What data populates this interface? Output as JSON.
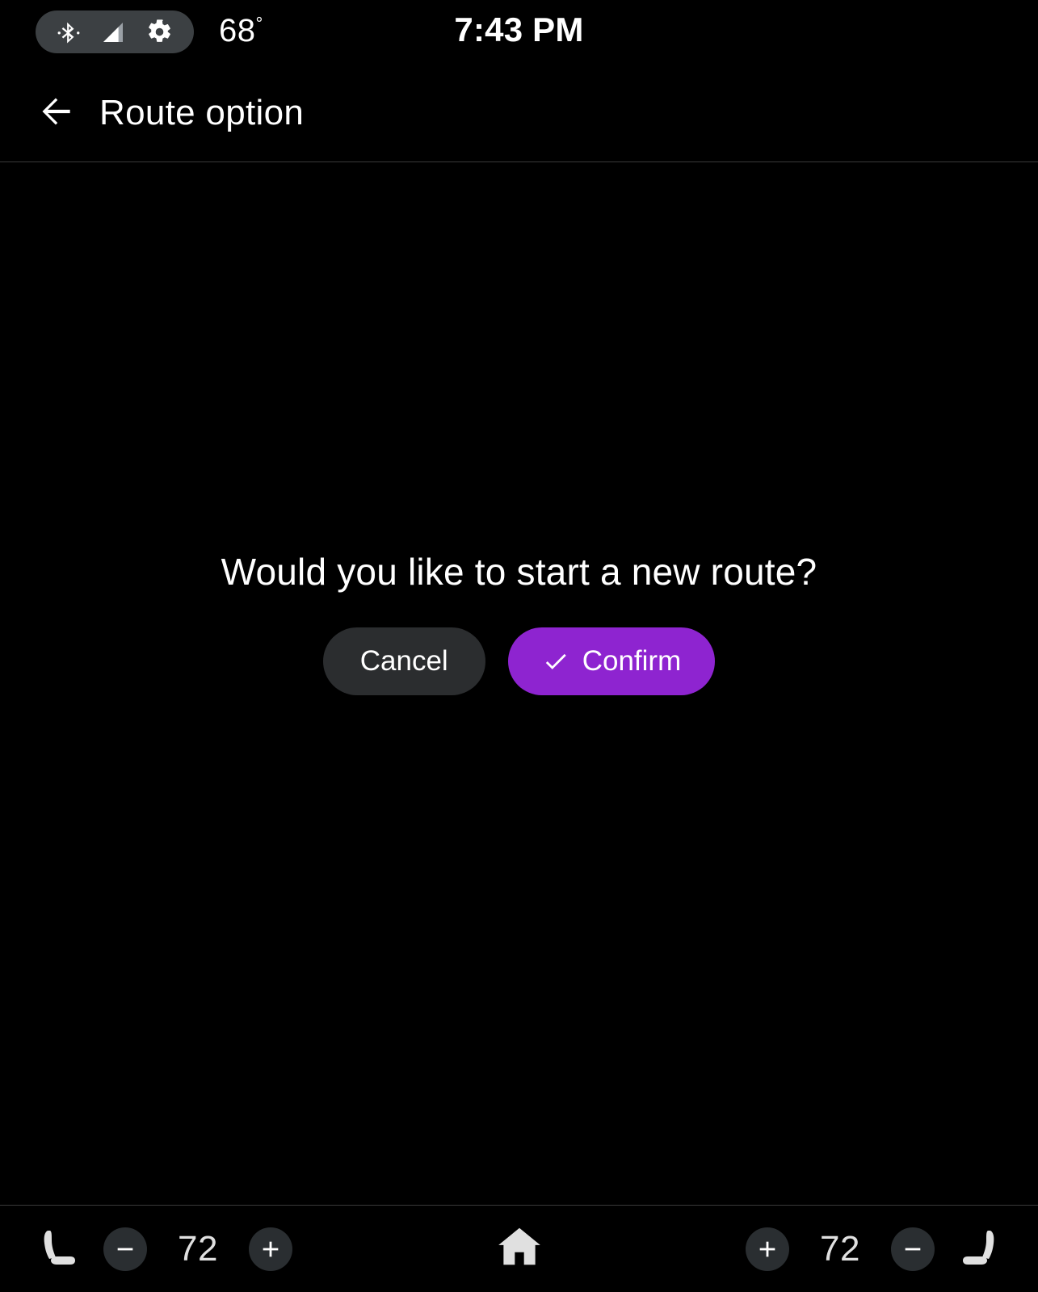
{
  "status_bar": {
    "icons": [
      {
        "name": "bluetooth-icon",
        "label": "Bluetooth"
      },
      {
        "name": "signal-cellular-icon",
        "label": "Cellular signal"
      },
      {
        "name": "gear-icon",
        "label": "Settings"
      }
    ],
    "temperature": "68",
    "degree_symbol": "°",
    "time": "7:43 PM",
    "pill_background": "#3C4043"
  },
  "header": {
    "back_icon": "arrow-left-icon",
    "title": "Route option"
  },
  "dialog": {
    "message": "Would you like to start a new route?",
    "cancel_label": "Cancel",
    "confirm_label": "Confirm",
    "confirm_icon": "check-icon",
    "cancel_color": "#2B2D2F",
    "confirm_color": "#8E24D0"
  },
  "bottom_bar": {
    "left": {
      "seat_icon": "seat-heater-icon",
      "decrease_label": "−",
      "temperature": "72",
      "increase_label": "+"
    },
    "center": {
      "home_icon": "home-icon"
    },
    "right": {
      "increase_label": "+",
      "temperature": "72",
      "decrease_label": "−",
      "seat_icon": "seat-heater-icon"
    },
    "button_color": "#2A2E31"
  }
}
